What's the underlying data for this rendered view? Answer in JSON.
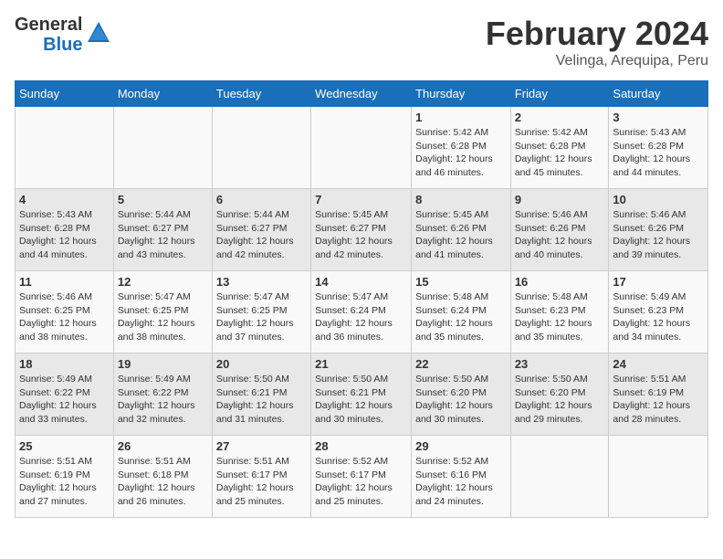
{
  "header": {
    "logo_general": "General",
    "logo_blue": "Blue",
    "month_year": "February 2024",
    "location": "Velinga, Arequipa, Peru"
  },
  "days_of_week": [
    "Sunday",
    "Monday",
    "Tuesday",
    "Wednesday",
    "Thursday",
    "Friday",
    "Saturday"
  ],
  "weeks": [
    [
      {
        "day": "",
        "info": ""
      },
      {
        "day": "",
        "info": ""
      },
      {
        "day": "",
        "info": ""
      },
      {
        "day": "",
        "info": ""
      },
      {
        "day": "1",
        "info": "Sunrise: 5:42 AM\nSunset: 6:28 PM\nDaylight: 12 hours and 46 minutes."
      },
      {
        "day": "2",
        "info": "Sunrise: 5:42 AM\nSunset: 6:28 PM\nDaylight: 12 hours and 45 minutes."
      },
      {
        "day": "3",
        "info": "Sunrise: 5:43 AM\nSunset: 6:28 PM\nDaylight: 12 hours and 44 minutes."
      }
    ],
    [
      {
        "day": "4",
        "info": "Sunrise: 5:43 AM\nSunset: 6:28 PM\nDaylight: 12 hours and 44 minutes."
      },
      {
        "day": "5",
        "info": "Sunrise: 5:44 AM\nSunset: 6:27 PM\nDaylight: 12 hours and 43 minutes."
      },
      {
        "day": "6",
        "info": "Sunrise: 5:44 AM\nSunset: 6:27 PM\nDaylight: 12 hours and 42 minutes."
      },
      {
        "day": "7",
        "info": "Sunrise: 5:45 AM\nSunset: 6:27 PM\nDaylight: 12 hours and 42 minutes."
      },
      {
        "day": "8",
        "info": "Sunrise: 5:45 AM\nSunset: 6:26 PM\nDaylight: 12 hours and 41 minutes."
      },
      {
        "day": "9",
        "info": "Sunrise: 5:46 AM\nSunset: 6:26 PM\nDaylight: 12 hours and 40 minutes."
      },
      {
        "day": "10",
        "info": "Sunrise: 5:46 AM\nSunset: 6:26 PM\nDaylight: 12 hours and 39 minutes."
      }
    ],
    [
      {
        "day": "11",
        "info": "Sunrise: 5:46 AM\nSunset: 6:25 PM\nDaylight: 12 hours and 38 minutes."
      },
      {
        "day": "12",
        "info": "Sunrise: 5:47 AM\nSunset: 6:25 PM\nDaylight: 12 hours and 38 minutes."
      },
      {
        "day": "13",
        "info": "Sunrise: 5:47 AM\nSunset: 6:25 PM\nDaylight: 12 hours and 37 minutes."
      },
      {
        "day": "14",
        "info": "Sunrise: 5:47 AM\nSunset: 6:24 PM\nDaylight: 12 hours and 36 minutes."
      },
      {
        "day": "15",
        "info": "Sunrise: 5:48 AM\nSunset: 6:24 PM\nDaylight: 12 hours and 35 minutes."
      },
      {
        "day": "16",
        "info": "Sunrise: 5:48 AM\nSunset: 6:23 PM\nDaylight: 12 hours and 35 minutes."
      },
      {
        "day": "17",
        "info": "Sunrise: 5:49 AM\nSunset: 6:23 PM\nDaylight: 12 hours and 34 minutes."
      }
    ],
    [
      {
        "day": "18",
        "info": "Sunrise: 5:49 AM\nSunset: 6:22 PM\nDaylight: 12 hours and 33 minutes."
      },
      {
        "day": "19",
        "info": "Sunrise: 5:49 AM\nSunset: 6:22 PM\nDaylight: 12 hours and 32 minutes."
      },
      {
        "day": "20",
        "info": "Sunrise: 5:50 AM\nSunset: 6:21 PM\nDaylight: 12 hours and 31 minutes."
      },
      {
        "day": "21",
        "info": "Sunrise: 5:50 AM\nSunset: 6:21 PM\nDaylight: 12 hours and 30 minutes."
      },
      {
        "day": "22",
        "info": "Sunrise: 5:50 AM\nSunset: 6:20 PM\nDaylight: 12 hours and 30 minutes."
      },
      {
        "day": "23",
        "info": "Sunrise: 5:50 AM\nSunset: 6:20 PM\nDaylight: 12 hours and 29 minutes."
      },
      {
        "day": "24",
        "info": "Sunrise: 5:51 AM\nSunset: 6:19 PM\nDaylight: 12 hours and 28 minutes."
      }
    ],
    [
      {
        "day": "25",
        "info": "Sunrise: 5:51 AM\nSunset: 6:19 PM\nDaylight: 12 hours and 27 minutes."
      },
      {
        "day": "26",
        "info": "Sunrise: 5:51 AM\nSunset: 6:18 PM\nDaylight: 12 hours and 26 minutes."
      },
      {
        "day": "27",
        "info": "Sunrise: 5:51 AM\nSunset: 6:17 PM\nDaylight: 12 hours and 25 minutes."
      },
      {
        "day": "28",
        "info": "Sunrise: 5:52 AM\nSunset: 6:17 PM\nDaylight: 12 hours and 25 minutes."
      },
      {
        "day": "29",
        "info": "Sunrise: 5:52 AM\nSunset: 6:16 PM\nDaylight: 12 hours and 24 minutes."
      },
      {
        "day": "",
        "info": ""
      },
      {
        "day": "",
        "info": ""
      }
    ]
  ]
}
